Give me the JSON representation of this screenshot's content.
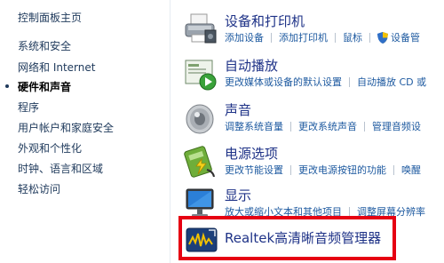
{
  "sidebar": {
    "items": [
      {
        "label": "控制面板主页",
        "active": false
      },
      {
        "label": "系统和安全",
        "active": false
      },
      {
        "label": "网络和 Internet",
        "active": false
      },
      {
        "label": "硬件和声音",
        "active": true
      },
      {
        "label": "程序",
        "active": false
      },
      {
        "label": "用户帐户和家庭安全",
        "active": false
      },
      {
        "label": "外观和个性化",
        "active": false
      },
      {
        "label": "时钟、语言和区域",
        "active": false
      },
      {
        "label": "轻松访问",
        "active": false
      }
    ]
  },
  "categories": [
    {
      "title": "设备和打印机",
      "icon": "printer-icon",
      "links": [
        "添加设备",
        "添加打印机",
        "鼠标",
        "设备管"
      ]
    },
    {
      "title": "自动播放",
      "icon": "autoplay-icon",
      "links": [
        "更改媒体或设备的默认设置",
        "自动播放 CD 或"
      ]
    },
    {
      "title": "声音",
      "icon": "speaker-icon",
      "links": [
        "调整系统音量",
        "更改系统声音",
        "管理音频设"
      ]
    },
    {
      "title": "电源选项",
      "icon": "battery-icon",
      "links": [
        "更改节能设置",
        "更改电源按钮的功能",
        "唤醒"
      ]
    },
    {
      "title": "显示",
      "icon": "monitor-icon",
      "links": [
        "放大或缩小文本和其他项目",
        "调整屏幕分辨率"
      ]
    }
  ],
  "realtek": {
    "label": "Realtek高清晰音频管理器",
    "icon": "realtek-audio-icon",
    "highlight_color": "#e60012"
  }
}
